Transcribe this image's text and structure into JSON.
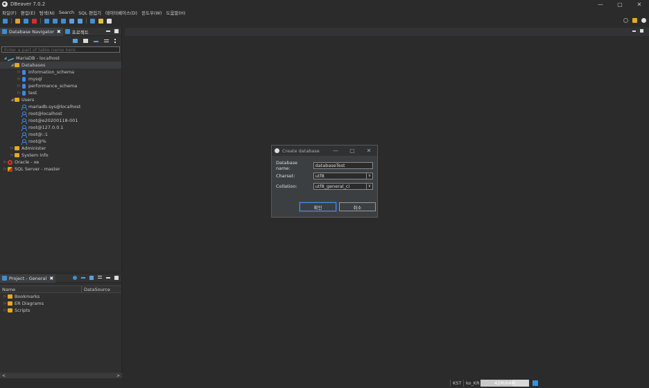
{
  "window": {
    "title": "DBeaver 7.0.2",
    "min": "—",
    "max": "▢",
    "close": "✕"
  },
  "menu": [
    "파일(F)",
    "편집(E)",
    "탐색(N)",
    "Search",
    "SQL 편집기",
    "데이터베이스(D)",
    "윈도우(W)",
    "도움말(H)"
  ],
  "nav": {
    "tab_active": "Database Navigator",
    "tab_other": "프로젝트",
    "filter_placeholder": "Enter a part of table name here",
    "tree": [
      {
        "label": "MariaDB - localhost",
        "level": 0,
        "icon": "mariadb-icon",
        "arrow": "◢"
      },
      {
        "label": "Databases",
        "level": 1,
        "icon": "folder-icon",
        "arrow": "◢",
        "selected": true
      },
      {
        "label": "information_schema",
        "level": 2,
        "icon": "database-icon",
        "arrow": "▷"
      },
      {
        "label": "mysql",
        "level": 2,
        "icon": "database-icon",
        "arrow": "▷"
      },
      {
        "label": "performance_schema",
        "level": 2,
        "icon": "database-icon",
        "arrow": "▷"
      },
      {
        "label": "test",
        "level": 2,
        "icon": "database-icon",
        "arrow": "▷"
      },
      {
        "label": "Users",
        "level": 1,
        "icon": "folder-icon",
        "arrow": "◢"
      },
      {
        "label": "mariadb.sys@localhost",
        "level": 2,
        "icon": "user-icon",
        "arrow": ""
      },
      {
        "label": "root@localhost",
        "level": 2,
        "icon": "user-icon",
        "arrow": ""
      },
      {
        "label": "root@e20200118-001",
        "level": 2,
        "icon": "user-icon",
        "arrow": ""
      },
      {
        "label": "root@127.0.0.1",
        "level": 2,
        "icon": "user-icon",
        "arrow": ""
      },
      {
        "label": "root@::1",
        "level": 2,
        "icon": "user-icon",
        "arrow": ""
      },
      {
        "label": "root@%",
        "level": 2,
        "icon": "user-icon",
        "arrow": ""
      },
      {
        "label": "Administer",
        "level": 1,
        "icon": "folder-icon",
        "arrow": "▷"
      },
      {
        "label": "System Info",
        "level": 1,
        "icon": "folder-icon",
        "arrow": "▷"
      },
      {
        "label": "Oracle - xe",
        "level": 0,
        "icon": "oracle-icon",
        "arrow": "▷"
      },
      {
        "label": "SQL Server - master",
        "level": 0,
        "icon": "sqlserver-icon",
        "arrow": "▷"
      }
    ]
  },
  "project": {
    "tab": "Project - General",
    "col_name": "Name",
    "col_datasource": "DataSource",
    "items": [
      {
        "label": "Bookmarks",
        "icon": "bookmarks-folder-icon"
      },
      {
        "label": "ER Diagrams",
        "icon": "folder-icon"
      },
      {
        "label": "Scripts",
        "icon": "scripts-folder-icon"
      }
    ],
    "scroll_left": "<",
    "scroll_right": ">"
  },
  "dialog": {
    "title": "Create database",
    "name_label": "Database name:",
    "name_value": "databaseTest",
    "charset_label": "Charset:",
    "charset_value": "utf8",
    "collation_label": "Collation:",
    "collation_value": "utf8_general_ci",
    "ok_label": "확인",
    "cancel_label": "취소",
    "dd_arrow": "∨"
  },
  "status": {
    "timezone": "KST",
    "locale": "ko_KR",
    "memory": "42M/64M",
    "memory_fraction": 0.66
  },
  "colors": {
    "accent": "#3d8ed6",
    "folder": "#e8a820",
    "background": "#2b2b2b"
  }
}
